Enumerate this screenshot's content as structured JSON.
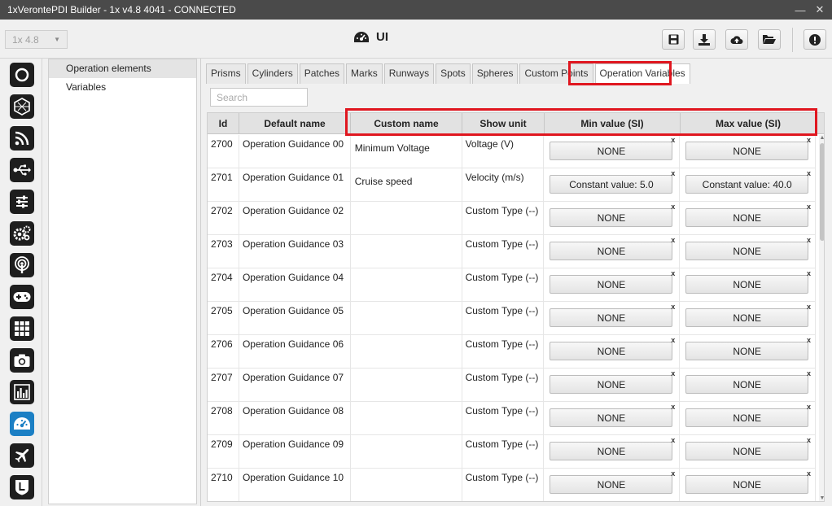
{
  "window": {
    "title": "1xVerontePDI Builder - 1x v4.8 4041 - CONNECTED",
    "minimize_icon": "minimize-icon",
    "close_icon": "close-icon"
  },
  "header": {
    "version_select": "1x 4.8",
    "page_title": "UI",
    "page_icon": "dashboard-gauge-icon",
    "buttons": [
      "save-icon",
      "download-icon",
      "cloud-upload-icon",
      "folder-open-icon",
      "info-icon"
    ]
  },
  "rail": {
    "items": [
      "power-icon",
      "hexagon-grid-icon",
      "feed-icon",
      "usb-icon",
      "sliders-icon",
      "gears-icon",
      "broadcast-icon",
      "gamepad-icon",
      "grid-icon",
      "camera-icon",
      "bar-chart-icon",
      "dashboard-gauge-icon",
      "airplane-icon",
      "shield-icon"
    ],
    "active_index": 11
  },
  "nav": {
    "items": [
      "Operation elements",
      "Variables"
    ],
    "selected_index": 0
  },
  "tabs": [
    "Prisms",
    "Cylinders",
    "Patches",
    "Marks",
    "Runways",
    "Spots",
    "Spheres",
    "Custom Points",
    "Operation Variables"
  ],
  "active_tab": "Operation Variables",
  "search": {
    "placeholder": "Search"
  },
  "table": {
    "headers": [
      "Id",
      "Default name",
      "Custom name",
      "Show unit",
      "Min value (SI)",
      "Max value (SI)"
    ],
    "clear_symbol": "x",
    "rows": [
      {
        "id": "2700",
        "default_name": "Operation Guidance 00",
        "custom_name": "Minimum Voltage",
        "unit": "Voltage (V)",
        "min": "NONE",
        "max": "NONE"
      },
      {
        "id": "2701",
        "default_name": "Operation Guidance 01",
        "custom_name": "Cruise speed",
        "unit": "Velocity (m/s)",
        "min": "Constant value: 5.0",
        "max": "Constant value: 40.0"
      },
      {
        "id": "2702",
        "default_name": "Operation Guidance 02",
        "custom_name": "",
        "unit": "Custom Type (--)",
        "min": "NONE",
        "max": "NONE"
      },
      {
        "id": "2703",
        "default_name": "Operation Guidance 03",
        "custom_name": "",
        "unit": "Custom Type (--)",
        "min": "NONE",
        "max": "NONE"
      },
      {
        "id": "2704",
        "default_name": "Operation Guidance 04",
        "custom_name": "",
        "unit": "Custom Type (--)",
        "min": "NONE",
        "max": "NONE"
      },
      {
        "id": "2705",
        "default_name": "Operation Guidance 05",
        "custom_name": "",
        "unit": "Custom Type (--)",
        "min": "NONE",
        "max": "NONE"
      },
      {
        "id": "2706",
        "default_name": "Operation Guidance 06",
        "custom_name": "",
        "unit": "Custom Type (--)",
        "min": "NONE",
        "max": "NONE"
      },
      {
        "id": "2707",
        "default_name": "Operation Guidance 07",
        "custom_name": "",
        "unit": "Custom Type (--)",
        "min": "NONE",
        "max": "NONE"
      },
      {
        "id": "2708",
        "default_name": "Operation Guidance 08",
        "custom_name": "",
        "unit": "Custom Type (--)",
        "min": "NONE",
        "max": "NONE"
      },
      {
        "id": "2709",
        "default_name": "Operation Guidance 09",
        "custom_name": "",
        "unit": "Custom Type (--)",
        "min": "NONE",
        "max": "NONE"
      },
      {
        "id": "2710",
        "default_name": "Operation Guidance 10",
        "custom_name": "",
        "unit": "Custom Type (--)",
        "min": "NONE",
        "max": "NONE"
      }
    ]
  },
  "colors": {
    "highlight": "#e0161f",
    "active_rail": "#1b7fc4",
    "titlebar": "#4a4a4a"
  }
}
